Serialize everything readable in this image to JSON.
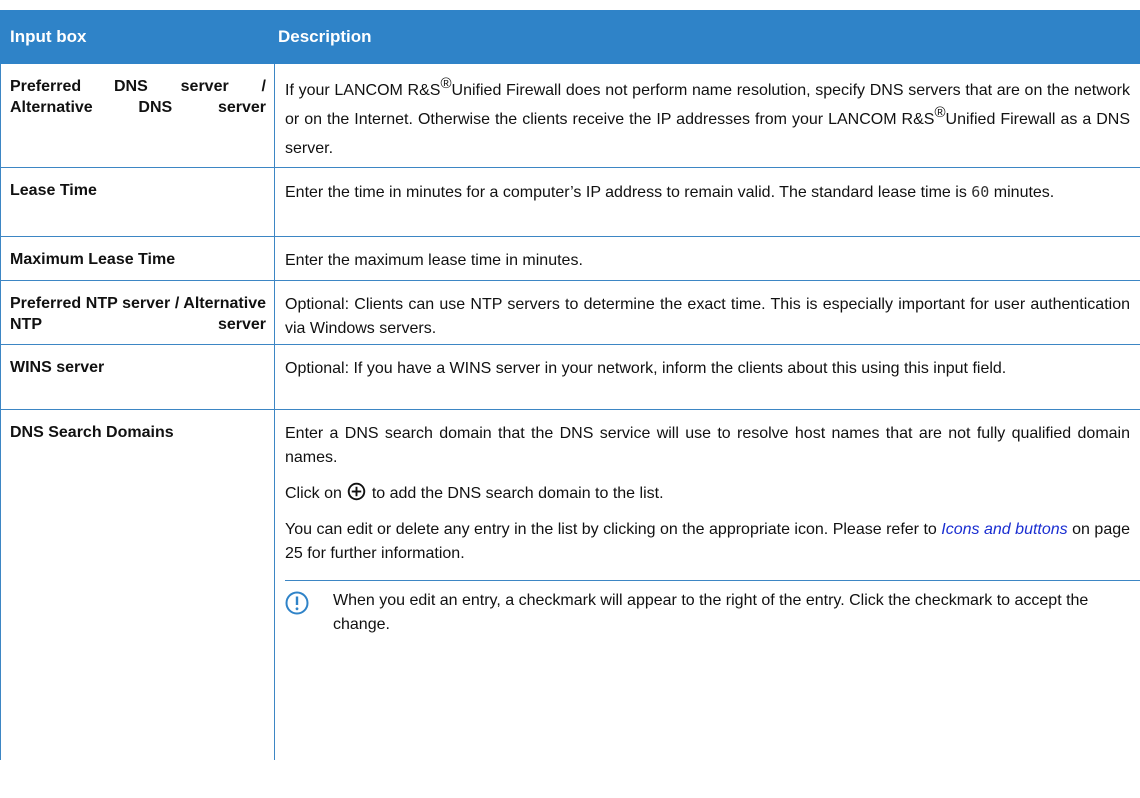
{
  "table": {
    "headers": {
      "col1": "Input box",
      "col2": "Description"
    },
    "rows": [
      {
        "field": "Preferred DNS server / Alternative DNS server",
        "desc_a": "If your LANCOM R&S",
        "reg": "®",
        "desc_b": "Unified Firewall does not perform name resolution, specify DNS servers that are on the network or on the Internet. Otherwise the clients receive the IP addresses from your LANCOM R&S",
        "desc_c": "Unified Firewall as a DNS server."
      },
      {
        "field": "Lease Time",
        "desc_a": "Enter the time in minutes for a computer’s IP address to remain valid. The standard lease time is",
        "code": "60",
        "desc_b": "minutes."
      },
      {
        "field": "Maximum Lease Time",
        "desc": "Enter the maximum lease time in minutes."
      },
      {
        "field": "Preferred NTP server / Alternative NTP server",
        "desc": "Optional: Clients can use NTP servers to determine the exact time. This is especially important for user authentication via Windows servers."
      },
      {
        "field": "WINS server",
        "desc": "Optional: If you have a WINS server in your network, inform the clients about this using this input field."
      },
      {
        "field": "DNS Search Domains",
        "para1": "Enter a DNS search domain that the DNS service will use to resolve host names that are not fully qualified domain names.",
        "para2_a": "Click on",
        "para2_b": "to add the DNS search domain to the list.",
        "para3_a": "You can edit or delete any entry in the list by clicking on the appropriate icon. Please refer to",
        "para3_link": "Icons and buttons",
        "para3_b": "on page 25 for further information.",
        "note": "When you edit an entry, a checkmark will appear to the right of the entry. Click the checkmark to accept the change."
      }
    ]
  },
  "colors": {
    "header_bg": "#2f83c8",
    "rule": "#3d86c4",
    "link": "#1a2ed1"
  },
  "icons": {
    "add": "circle-plus-icon",
    "note": "exclamation-circle-icon"
  }
}
